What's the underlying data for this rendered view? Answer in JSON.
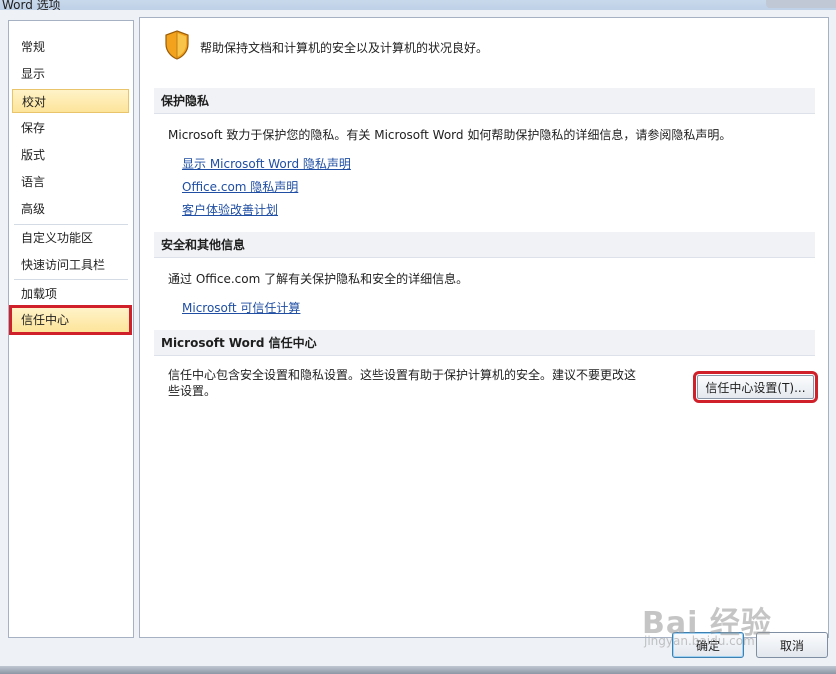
{
  "window": {
    "title": "Word 选项"
  },
  "nav": {
    "items": [
      {
        "label": "常规"
      },
      {
        "label": "显示"
      },
      {
        "label": "校对"
      },
      {
        "label": "保存"
      },
      {
        "label": "版式"
      },
      {
        "label": "语言"
      },
      {
        "label": "高级"
      },
      {
        "label": "自定义功能区"
      },
      {
        "label": "快速访问工具栏"
      },
      {
        "label": "加载项"
      },
      {
        "label": "信任中心"
      }
    ],
    "selected": "校对",
    "highlighted": "信任中心"
  },
  "main": {
    "intro": "帮助保持文档和计算机的安全以及计算机的状况良好。",
    "privacy": {
      "heading": "保护隐私",
      "text": "Microsoft 致力于保护您的隐私。有关 Microsoft Word 如何帮助保护隐私的详细信息，请参阅隐私声明。",
      "links": [
        "显示 Microsoft Word 隐私声明",
        "Office.com 隐私声明",
        "客户体验改善计划"
      ]
    },
    "security": {
      "heading": "安全和其他信息",
      "text": "通过 Office.com 了解有关保护隐私和安全的详细信息。",
      "link": "Microsoft 可信任计算"
    },
    "trust_center": {
      "heading": "Microsoft Word 信任中心",
      "text": "信任中心包含安全设置和隐私设置。这些设置有助于保护计算机的安全。建议不要更改这些设置。",
      "button": "信任中心设置(T)..."
    }
  },
  "footer": {
    "ok": "确定",
    "cancel": "取消"
  },
  "watermark": {
    "main": "Bai 经验",
    "sub": "jingyan.baidu.com"
  },
  "colors": {
    "highlight_border": "#d0202a",
    "selected_bg": "#fde49a",
    "link": "#1f4ea3"
  }
}
